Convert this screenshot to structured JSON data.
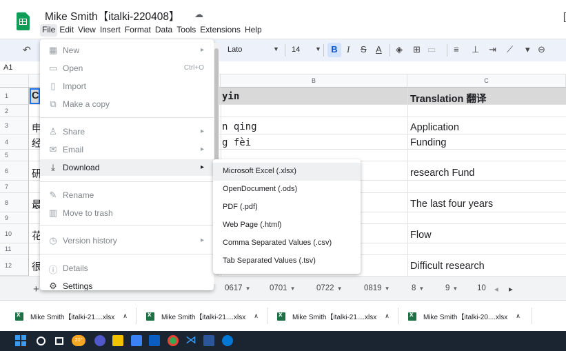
{
  "app": {
    "title": "Mike Smith【italki-220408】"
  },
  "menubar": [
    "File",
    "Edit",
    "View",
    "Insert",
    "Format",
    "Data",
    "Tools",
    "Extensions",
    "Help"
  ],
  "toolbar": {
    "font": "Lato",
    "font_size": "14",
    "bold_glyph": "B",
    "italic_glyph": "I",
    "strike_glyph": "S",
    "textcolor_glyph": "A"
  },
  "namebox": "A1",
  "grid": {
    "col_headers": [
      "B",
      "C"
    ],
    "rows": [
      "1",
      "2",
      "3",
      "4",
      "5",
      "6",
      "7",
      "8",
      "9",
      "10",
      "11",
      "12"
    ],
    "col_a_partial": [
      "C",
      "申",
      "经",
      "研",
      "最",
      "花",
      "很"
    ],
    "col_b_partial": [
      "yin",
      "n qing",
      "g fèi"
    ],
    "col_c": [
      "Translation 翻译",
      "Application",
      "Funding",
      "research Fund",
      "The last four years",
      "Flow",
      "Difficult research"
    ]
  },
  "file_menu": {
    "items": [
      {
        "label": "New",
        "shortcut": "",
        "icon": "new-sheet-icon"
      },
      {
        "label": "Open",
        "shortcut": "Ctrl+O",
        "icon": "folder-icon"
      },
      {
        "label": "Import",
        "shortcut": "",
        "icon": "import-file-icon"
      },
      {
        "label": "Make a copy",
        "shortcut": "",
        "icon": "copy-icon"
      },
      {
        "label": "Share",
        "shortcut": "",
        "icon": "share-person-icon"
      },
      {
        "label": "Email",
        "shortcut": "",
        "icon": "mail-icon"
      },
      {
        "label": "Download",
        "shortcut": "",
        "icon": "download-icon"
      },
      {
        "label": "Rename",
        "shortcut": "",
        "icon": "pencil-icon"
      },
      {
        "label": "Move to trash",
        "shortcut": "",
        "icon": "trash-icon"
      },
      {
        "label": "Version history",
        "shortcut": "",
        "icon": "history-icon"
      },
      {
        "label": "Details",
        "shortcut": "",
        "icon": "info-icon"
      },
      {
        "label": "Settings",
        "shortcut": "",
        "icon": "gear-icon"
      }
    ]
  },
  "download_submenu": [
    "Microsoft Excel (.xlsx)",
    "OpenDocument (.ods)",
    "PDF (.pdf)",
    "Web Page (.html)",
    "Comma Separated Values (.csv)",
    "Tab Separated Values (.tsv)"
  ],
  "sheet_tabs": [
    "0617",
    "0701",
    "0722",
    "0819",
    "8",
    "9",
    "10"
  ],
  "downloads": [
    "Mike Smith【italki-21....xlsx",
    "Mike Smith【italki-21....xlsx",
    "Mike Smith【italki-21....xlsx",
    "Mike Smith【italki-20....xlsx"
  ],
  "taskbar": {
    "weather": "20°"
  },
  "colors": {
    "accent": "#1a73e8",
    "sheets_green": "#0f9d58",
    "toolbar_bg": "#edf2fa",
    "taskbar_bg": "#1b2431"
  }
}
